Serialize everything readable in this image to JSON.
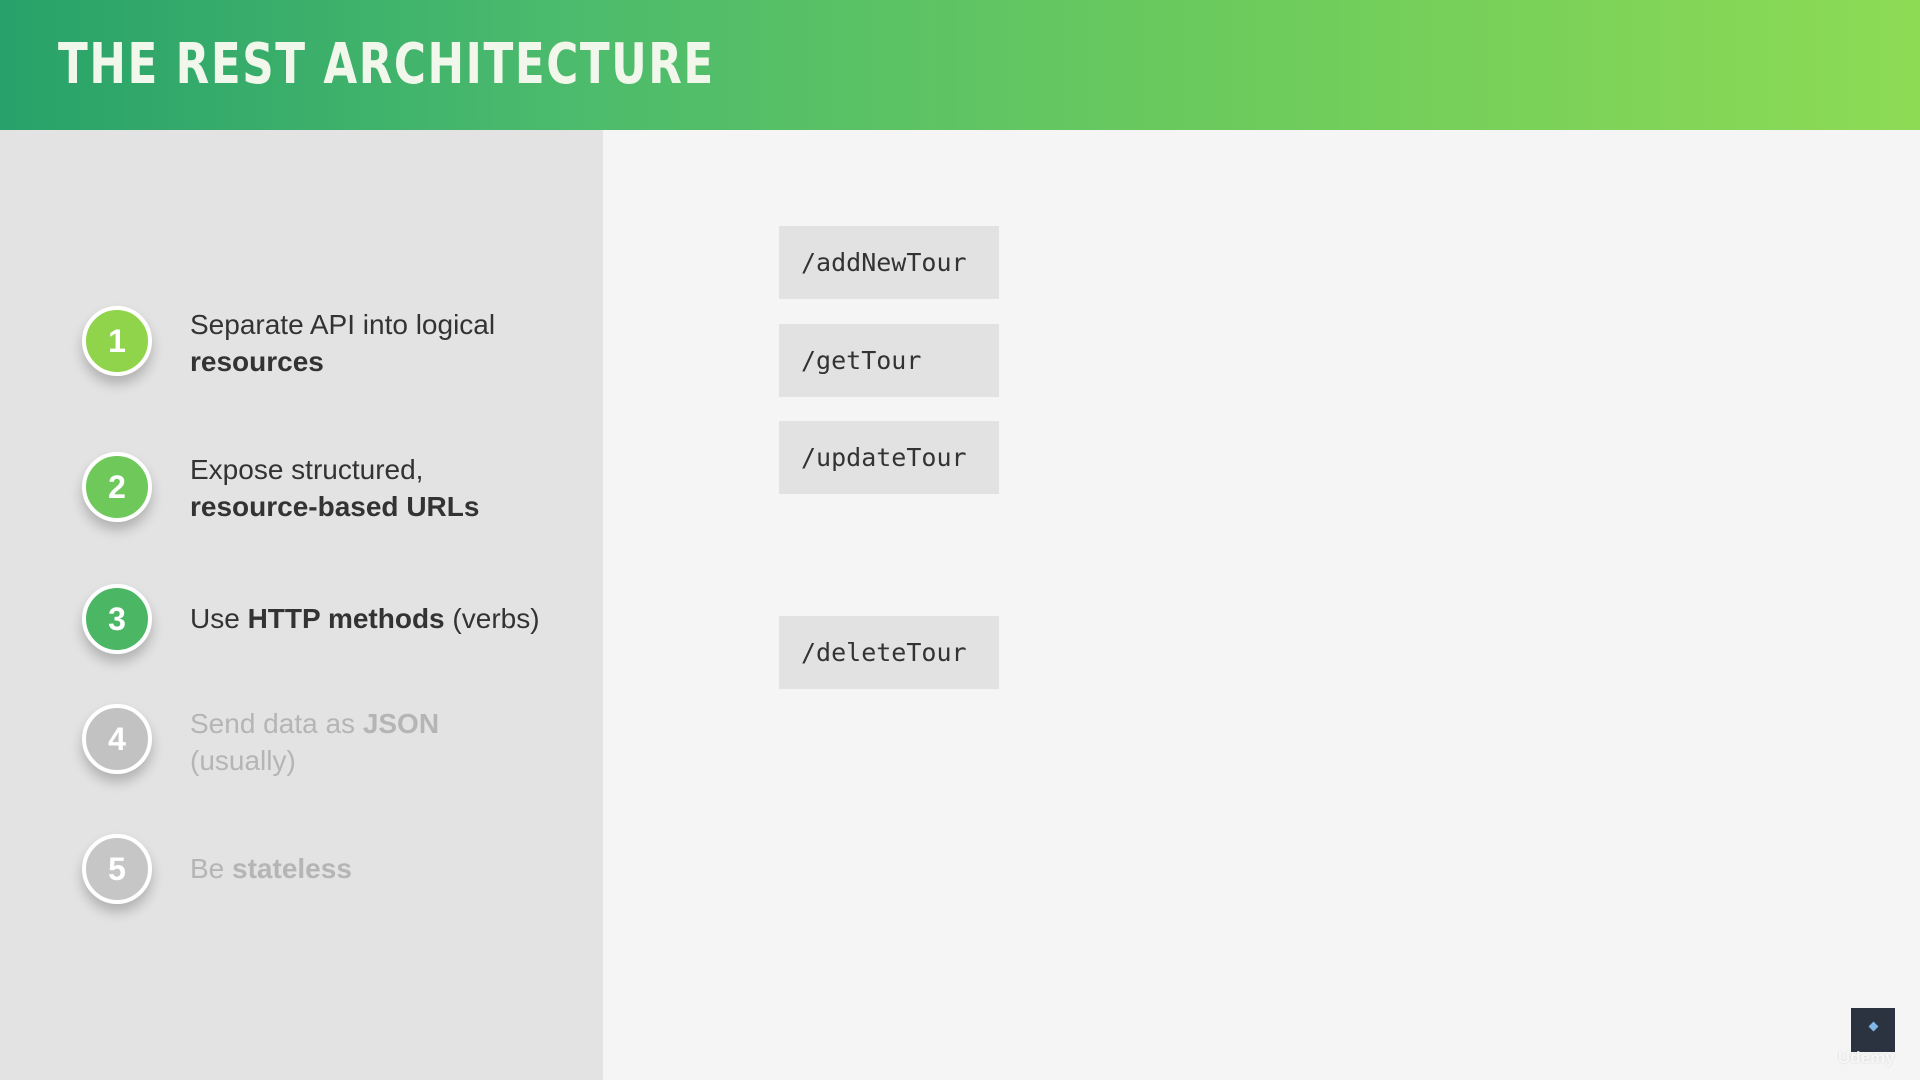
{
  "slide": {
    "title": "THE REST ARCHITECTURE"
  },
  "steps": [
    {
      "number": "1",
      "text_plain": "Separate API into logical",
      "text_bold": "resources",
      "state": "active"
    },
    {
      "number": "2",
      "text_plain": "Expose structured,",
      "text_bold": "resource-based URLs",
      "state": "active"
    },
    {
      "number": "3",
      "text_before": "Use ",
      "text_bold": "HTTP methods",
      "text_after": " (verbs)",
      "state": "active"
    },
    {
      "number": "4",
      "text_before": "Send data as ",
      "text_bold": "JSON",
      "text_after": "(usually)",
      "state": "inactive"
    },
    {
      "number": "5",
      "text_before": "Be ",
      "text_bold": "stateless",
      "state": "inactive"
    }
  ],
  "routes": [
    "/addNewTour",
    "/getTour",
    "/updateTour",
    "/deleteTour"
  ],
  "branding": {
    "watermark": "Udemy",
    "logo_icon": "course-logo-icon"
  },
  "colors": {
    "header_gradient_start": "#28a26a",
    "header_gradient_end": "#8ddb55",
    "step1": "#8fd44a",
    "step2": "#6ec95a",
    "step3": "#4bb664",
    "inactive_step": "#c2c2c2"
  }
}
